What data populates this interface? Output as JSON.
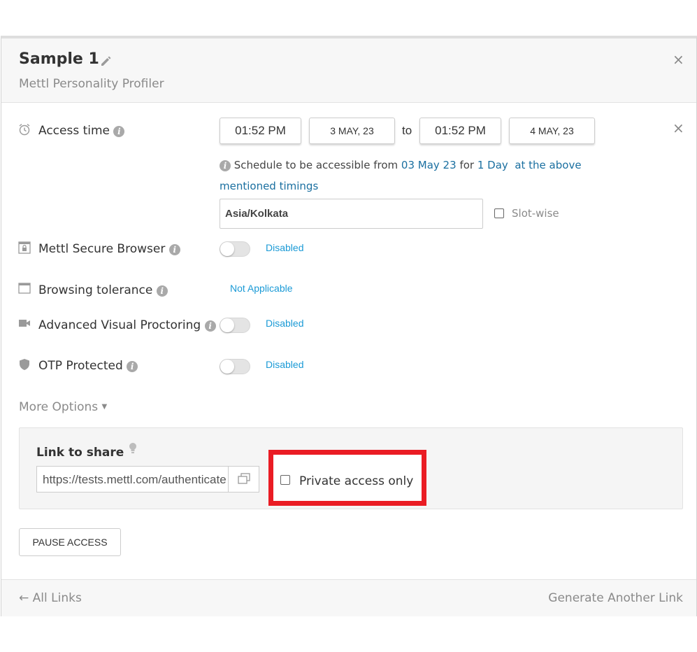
{
  "header": {
    "title": "Sample 1",
    "subtitle": "Mettl Personality Profiler",
    "close": "×"
  },
  "access_time": {
    "label": "Access time",
    "start_time": "01:52 PM",
    "start_date": "3 MAY, 23",
    "to": "to",
    "end_time": "01:52 PM",
    "end_date": "4 MAY, 23",
    "close": "×",
    "schedule_prefix": "Schedule to be accessible from",
    "schedule_date": "03 May 23",
    "schedule_for": "for",
    "schedule_duration": "1 Day",
    "schedule_suffix": "at the above mentioned timings",
    "timezone": "Asia/Kolkata",
    "slotwise": "Slot-wise"
  },
  "settings": {
    "secure_browser": {
      "label": "Mettl Secure Browser",
      "status": "Disabled"
    },
    "browsing_tolerance": {
      "label": "Browsing tolerance",
      "status": "Not Applicable"
    },
    "visual_proctoring": {
      "label": "Advanced Visual Proctoring",
      "status": "Disabled"
    },
    "otp": {
      "label": "OTP Protected",
      "status": "Disabled"
    }
  },
  "more_options": "More Options",
  "share": {
    "title": "Link to share",
    "url": "https://tests.mettl.com/authenticate",
    "private_access": "Private access only"
  },
  "pause_button": "PAUSE ACCESS",
  "footer": {
    "all_links": "← All Links",
    "generate": "Generate Another Link"
  },
  "colors": {
    "link_blue": "#1a9ad6",
    "highlight_red": "#ea1c24"
  }
}
